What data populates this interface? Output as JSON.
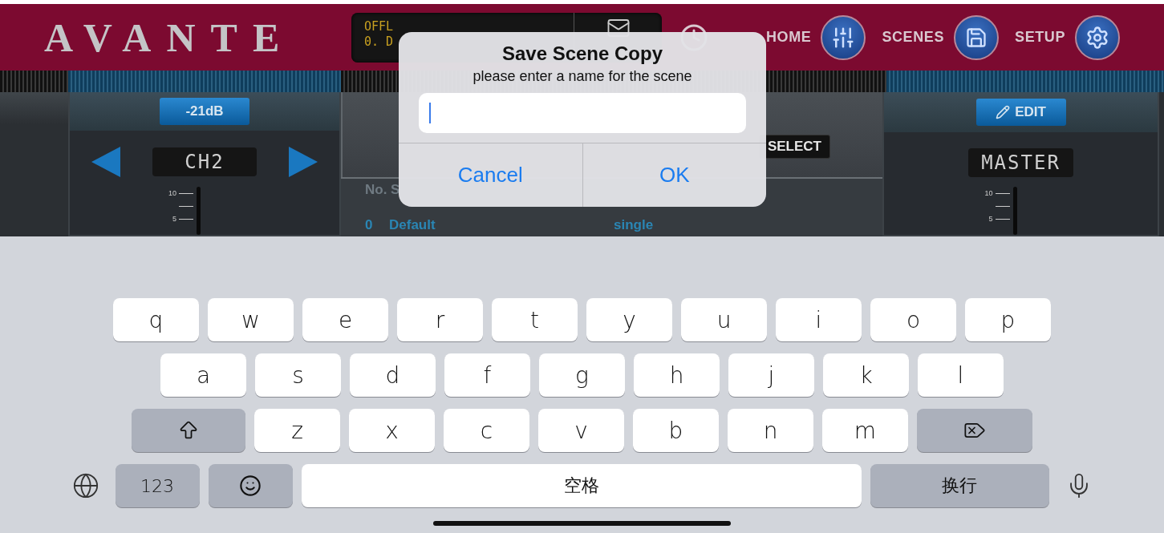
{
  "header": {
    "logo": "AVANTE",
    "display_lines": [
      "OFFL",
      "0. D"
    ],
    "nav": [
      {
        "label": "HOME"
      },
      {
        "label": "SCENES"
      },
      {
        "label": "SETUP"
      }
    ]
  },
  "left_channel": {
    "level_button": "-21dB",
    "channel": "CH2",
    "scale": [
      "10",
      "5"
    ]
  },
  "scenes": {
    "select_button": "SELECT",
    "column_header": "No. S",
    "rows": [
      {
        "number": "0",
        "name": "Default",
        "type": "single"
      }
    ]
  },
  "right_channel": {
    "edit_button": "EDIT",
    "channel": "MASTER",
    "scale": [
      "10",
      "5"
    ]
  },
  "dialog": {
    "title": "Save Scene Copy",
    "message": "please enter a name for the scene",
    "buttons": [
      "Cancel",
      "OK"
    ]
  },
  "keyboard": {
    "letter_rows": [
      [
        {
          "kind": "letter",
          "label": "q"
        },
        {
          "kind": "letter",
          "label": "w"
        },
        {
          "kind": "letter",
          "label": "e"
        },
        {
          "kind": "letter",
          "label": "r"
        },
        {
          "kind": "letter",
          "label": "t"
        },
        {
          "kind": "letter",
          "label": "y"
        },
        {
          "kind": "letter",
          "label": "u"
        },
        {
          "kind": "letter",
          "label": "i"
        },
        {
          "kind": "letter",
          "label": "o"
        },
        {
          "kind": "letter",
          "label": "p"
        }
      ],
      [
        {
          "kind": "letter",
          "label": "a"
        },
        {
          "kind": "letter",
          "label": "s"
        },
        {
          "kind": "letter",
          "label": "d"
        },
        {
          "kind": "letter",
          "label": "f"
        },
        {
          "kind": "letter",
          "label": "g"
        },
        {
          "kind": "letter",
          "label": "h"
        },
        {
          "kind": "letter",
          "label": "j"
        },
        {
          "kind": "letter",
          "label": "k"
        },
        {
          "kind": "letter",
          "label": "l"
        }
      ],
      [
        {
          "kind": "shift"
        },
        {
          "kind": "letter",
          "label": "z"
        },
        {
          "kind": "letter",
          "label": "x"
        },
        {
          "kind": "letter",
          "label": "c"
        },
        {
          "kind": "letter",
          "label": "v"
        },
        {
          "kind": "letter",
          "label": "b"
        },
        {
          "kind": "letter",
          "label": "n"
        },
        {
          "kind": "letter",
          "label": "m"
        },
        {
          "kind": "backspace"
        }
      ]
    ],
    "bottom_row": {
      "mode_key": "123",
      "space_key": "空格",
      "return_key": "换行"
    }
  }
}
